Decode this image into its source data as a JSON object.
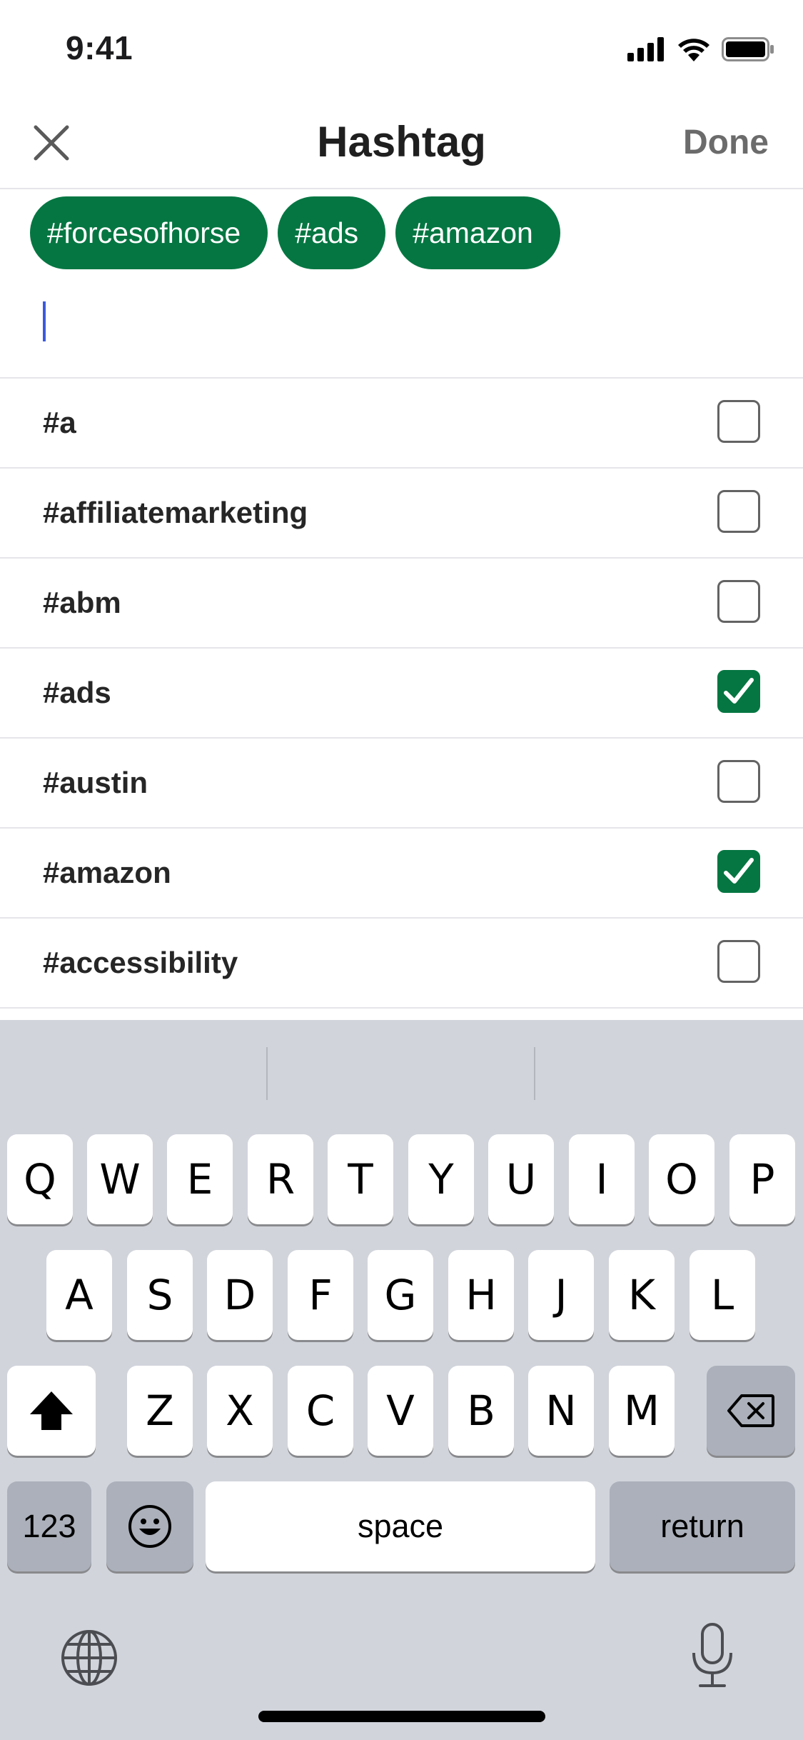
{
  "status_bar": {
    "time": "9:41"
  },
  "header": {
    "title": "Hashtag",
    "done_label": "Done"
  },
  "selected_hashtags": [
    "#forcesofhorse",
    "#ads",
    "#amazon"
  ],
  "suggestions": [
    {
      "label": "#a",
      "checked": false
    },
    {
      "label": "#affiliatemarketing",
      "checked": false
    },
    {
      "label": "#abm",
      "checked": false
    },
    {
      "label": "#ads",
      "checked": true
    },
    {
      "label": "#austin",
      "checked": false
    },
    {
      "label": "#amazon",
      "checked": true
    },
    {
      "label": "#accessibility",
      "checked": false
    }
  ],
  "keyboard": {
    "row1": [
      "Q",
      "W",
      "E",
      "R",
      "T",
      "Y",
      "U",
      "I",
      "O",
      "P"
    ],
    "row2": [
      "A",
      "S",
      "D",
      "F",
      "G",
      "H",
      "J",
      "K",
      "L"
    ],
    "row3": [
      "Z",
      "X",
      "C",
      "V",
      "B",
      "N",
      "M"
    ],
    "numbers_label": "123",
    "space_label": "space",
    "return_label": "return"
  },
  "colors": {
    "accent_green": "#057642",
    "caret_blue": "#3b5bdb",
    "keyboard_bg": "#d1d4db"
  }
}
